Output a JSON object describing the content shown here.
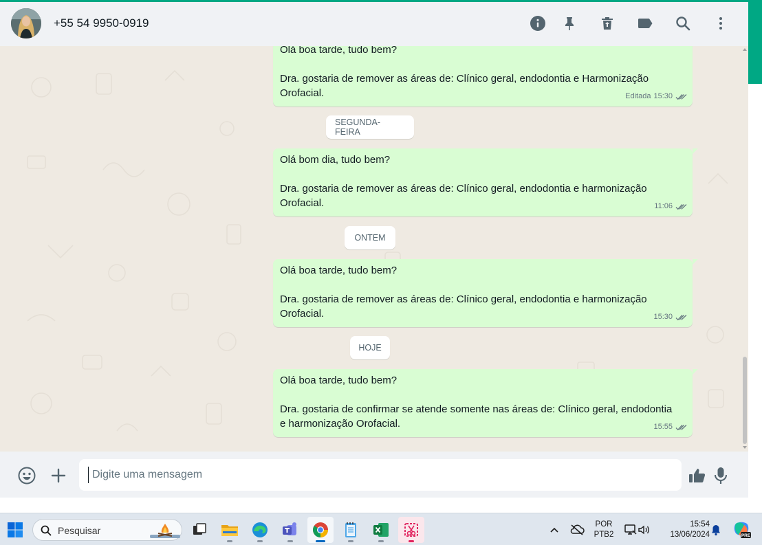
{
  "header": {
    "contact_name": "+55 54 9950-0919",
    "icons": [
      "info-icon",
      "pin-icon",
      "delete-icon",
      "label-icon",
      "search-icon",
      "menu-icon"
    ]
  },
  "chat": {
    "messages": [
      {
        "lines": [
          "Olá boa tarde, tudo bem?",
          "",
          "Dra. gostaria de remover as áreas de: Clínico geral, endodontia e  Harmonização",
          "Orofacial."
        ],
        "edited_label": "Editada",
        "time": "15:30",
        "status": "read"
      },
      {
        "lines": [
          "Olá bom dia, tudo bem?",
          "",
          "Dra. gostaria de remover as áreas de: Clínico geral, endodontia e harmonização",
          "Orofacial."
        ],
        "time": "11:06",
        "status": "read"
      },
      {
        "lines": [
          "Olá boa tarde, tudo bem?",
          "",
          "Dra. gostaria de remover as áreas de: Clínico geral, endodontia e harmonização",
          "Orofacial."
        ],
        "time": "15:30",
        "status": "read"
      },
      {
        "lines": [
          "Olá boa tarde, tudo bem?",
          "",
          "Dra. gostaria de confirmar se atende somente nas áreas de: Clínico geral, endodontia",
          "e harmonização Orofacial."
        ],
        "time": "15:55",
        "status": "read"
      }
    ],
    "day_dividers": [
      "SEGUNDA-FEIRA",
      "ONTEM",
      "HOJE"
    ]
  },
  "composer": {
    "placeholder": "Digite uma mensagem",
    "value": "",
    "icons": [
      "emoji-icon",
      "attach-plus-icon",
      "thumbs-up-sticker-icon",
      "microphone-icon"
    ]
  },
  "taskbar": {
    "search_placeholder": "Pesquisar",
    "apps": [
      "start-icon",
      "task-view-icon",
      "file-explorer-icon",
      "edge-icon",
      "teams-icon",
      "chrome-icon",
      "notepad-icon",
      "excel-icon",
      "snipping-tool-icon"
    ],
    "active_app": "chrome-icon",
    "tray": {
      "language_line1": "POR",
      "language_line2": "PTB2",
      "time": "15:54",
      "date": "13/06/2024",
      "copilot_badge": "PRE"
    }
  },
  "colors": {
    "accent": "#00a884",
    "chat_background": "#efeae2",
    "outgoing_bubble": "#d9fdd3",
    "header_background": "#f0f2f5",
    "read_ticks": "#667781"
  }
}
